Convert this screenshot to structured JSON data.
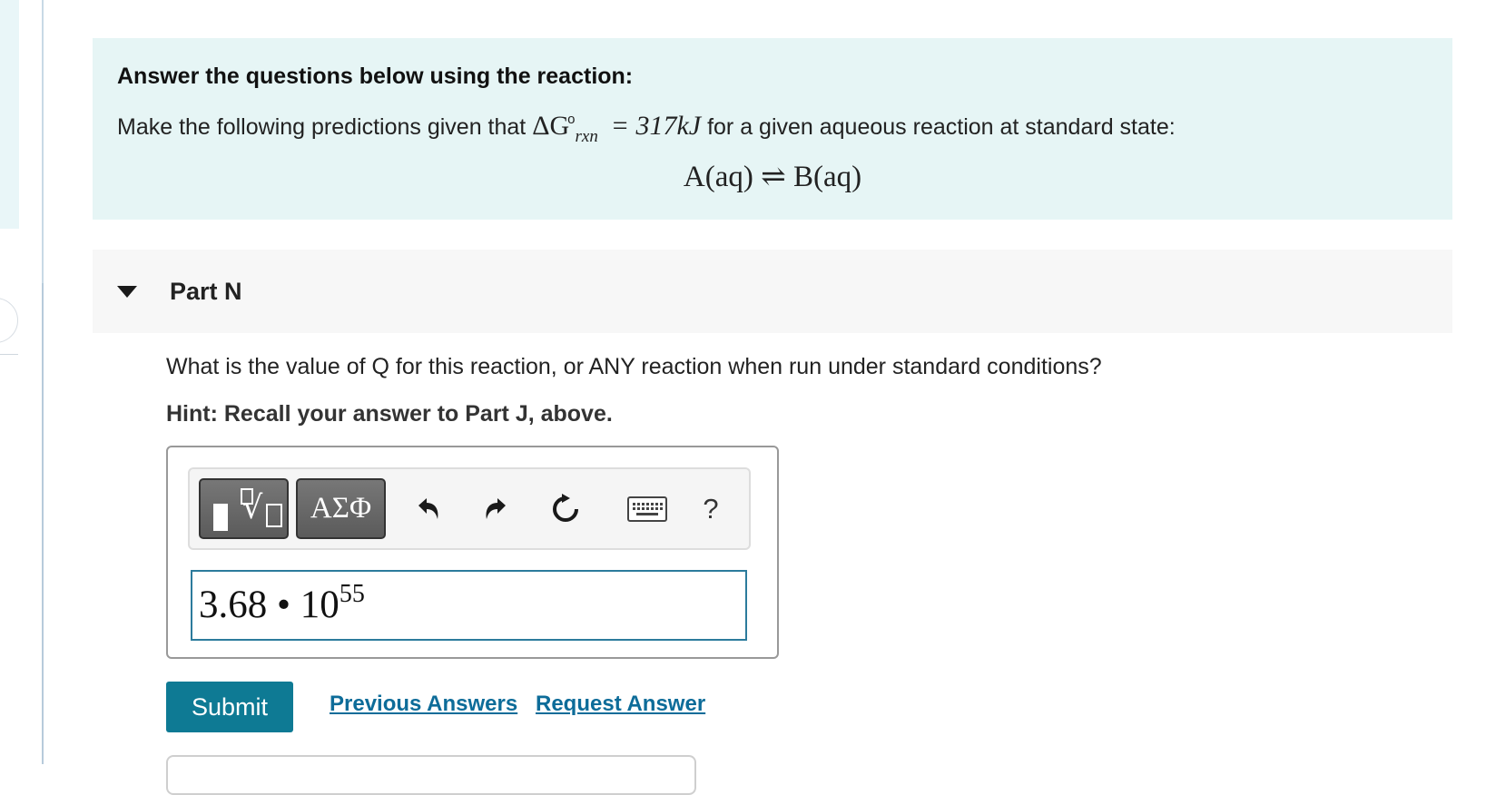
{
  "intro": {
    "title": "Answer the questions below using the reaction:",
    "text_before": "Make the following predictions given that ",
    "delta_g_symbol": "ΔG",
    "delta_g_sub": "rxn",
    "delta_g_sup": "o",
    "delta_g_value": "= 317kJ",
    "text_after": " for a given aqueous reaction at standard state:",
    "equation": "A(aq) ⇌ B(aq)"
  },
  "part": {
    "title": "Part N",
    "question": "What is the value of Q for this reaction, or ANY reaction when run under standard conditions?",
    "hint": "Hint: Recall your answer to Part J, above."
  },
  "toolbar": {
    "templates_icon": "templates-icon",
    "greek_label": "ΑΣΦ",
    "undo_icon": "undo-icon",
    "redo_icon": "redo-icon",
    "reset_icon": "reset-icon",
    "keyboard_icon": "keyboard-icon",
    "help_label": "?"
  },
  "answer": {
    "mantissa": "3.68 • 10",
    "exponent": "55"
  },
  "actions": {
    "submit_label": "Submit",
    "previous_answers_label": "Previous Answers",
    "request_answer_label": "Request Answer"
  },
  "colors": {
    "intro_bg": "#e6f5f5",
    "part_header_bg": "#f7f7f7",
    "submit_bg": "#0e7a94",
    "link": "#0d6c99",
    "input_border": "#2c7b9c"
  }
}
